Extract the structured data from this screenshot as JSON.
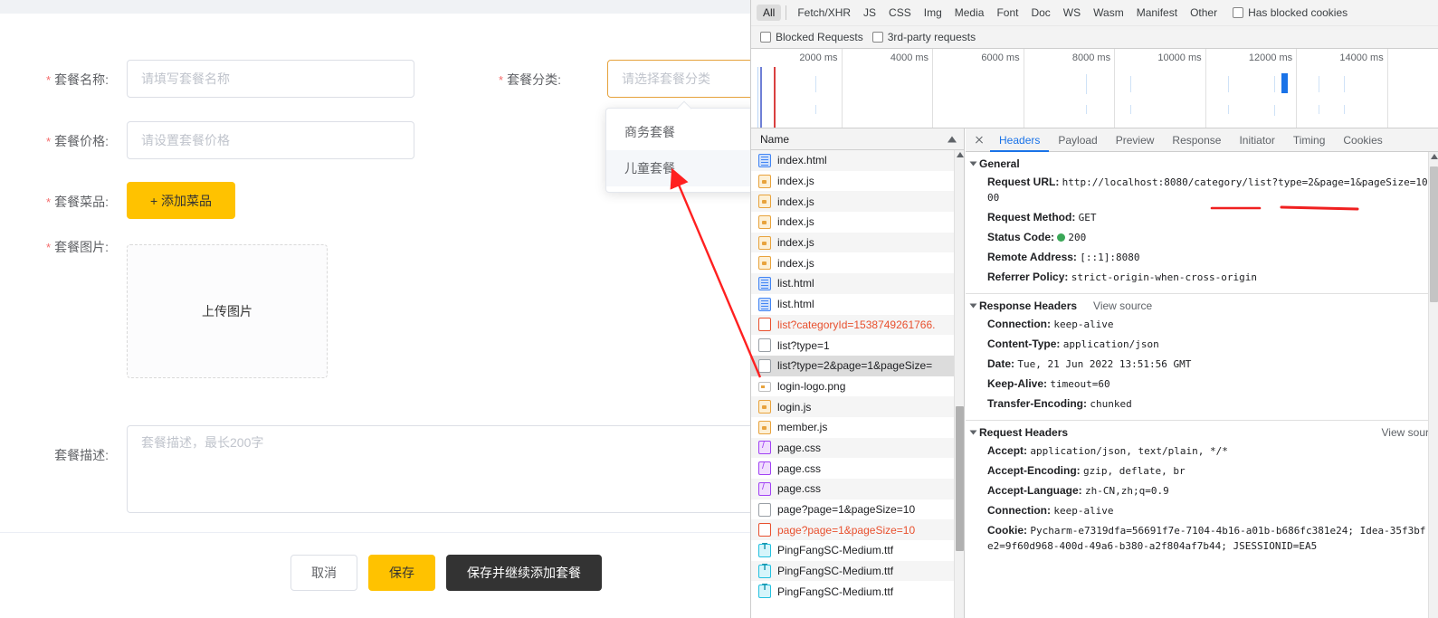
{
  "app_form": {
    "fields": {
      "name_label": "套餐名称:",
      "name_placeholder": "请填写套餐名称",
      "price_label": "套餐价格:",
      "price_placeholder": "请设置套餐价格",
      "dishes_label": "套餐菜品:",
      "add_dish_button": "+ 添加菜品",
      "image_label": "套餐图片:",
      "upload_text": "上传图片",
      "category_label": "套餐分类:",
      "category_placeholder": "请选择套餐分类",
      "desc_label": "套餐描述:",
      "desc_placeholder": "套餐描述，最长200字"
    },
    "category_options": [
      {
        "label": "商务套餐",
        "hover": false
      },
      {
        "label": "儿童套餐",
        "hover": true
      }
    ],
    "footer_buttons": {
      "cancel": "取消",
      "save": "保存",
      "save_continue": "保存并继续添加套餐"
    },
    "colors": {
      "primary_yellow": "#ffc200",
      "dark_button": "#333333",
      "required_star": "#f56c6c",
      "focus_border": "#e6a23c"
    }
  },
  "devtools": {
    "filter_types": [
      {
        "label": "All",
        "active": true
      },
      {
        "label": "Fetch/XHR",
        "active": false
      },
      {
        "label": "JS",
        "active": false
      },
      {
        "label": "CSS",
        "active": false
      },
      {
        "label": "Img",
        "active": false
      },
      {
        "label": "Media",
        "active": false
      },
      {
        "label": "Font",
        "active": false
      },
      {
        "label": "Doc",
        "active": false
      },
      {
        "label": "WS",
        "active": false
      },
      {
        "label": "Wasm",
        "active": false
      },
      {
        "label": "Manifest",
        "active": false
      },
      {
        "label": "Other",
        "active": false
      }
    ],
    "checkboxes": {
      "has_blocked_cookies": "Has blocked cookies",
      "blocked_requests": "Blocked Requests",
      "third_party_requests": "3rd-party requests"
    },
    "timeline_ticks": [
      "2000 ms",
      "4000 ms",
      "6000 ms",
      "8000 ms",
      "10000 ms",
      "12000 ms",
      "14000 ms"
    ],
    "name_column_header": "Name",
    "requests": [
      {
        "name": "index.html",
        "icon": "doc-icon",
        "error": false,
        "selected": false
      },
      {
        "name": "index.js",
        "icon": "js-icon",
        "error": false,
        "selected": false
      },
      {
        "name": "index.js",
        "icon": "js-icon",
        "error": false,
        "selected": false
      },
      {
        "name": "index.js",
        "icon": "js-icon",
        "error": false,
        "selected": false
      },
      {
        "name": "index.js",
        "icon": "js-icon",
        "error": false,
        "selected": false
      },
      {
        "name": "index.js",
        "icon": "js-icon",
        "error": false,
        "selected": false
      },
      {
        "name": "list.html",
        "icon": "doc-icon",
        "error": false,
        "selected": false
      },
      {
        "name": "list.html",
        "icon": "doc-icon",
        "error": false,
        "selected": false
      },
      {
        "name": "list?categoryId=1538749261766.",
        "icon": "xhr-error-icon",
        "error": true,
        "selected": false
      },
      {
        "name": "list?type=1",
        "icon": "xhr-icon",
        "error": false,
        "selected": false
      },
      {
        "name": "list?type=2&page=1&pageSize=",
        "icon": "xhr-icon",
        "error": false,
        "selected": true
      },
      {
        "name": "login-logo.png",
        "icon": "image-icon",
        "error": false,
        "selected": false
      },
      {
        "name": "login.js",
        "icon": "js-icon",
        "error": false,
        "selected": false
      },
      {
        "name": "member.js",
        "icon": "js-icon",
        "error": false,
        "selected": false
      },
      {
        "name": "page.css",
        "icon": "css-icon",
        "error": false,
        "selected": false
      },
      {
        "name": "page.css",
        "icon": "css-icon",
        "error": false,
        "selected": false
      },
      {
        "name": "page.css",
        "icon": "css-icon",
        "error": false,
        "selected": false
      },
      {
        "name": "page?page=1&pageSize=10",
        "icon": "xhr-icon",
        "error": false,
        "selected": false
      },
      {
        "name": "page?page=1&pageSize=10",
        "icon": "xhr-error-icon",
        "error": true,
        "selected": false
      },
      {
        "name": "PingFangSC-Medium.ttf",
        "icon": "font-icon",
        "error": false,
        "selected": false
      },
      {
        "name": "PingFangSC-Medium.ttf",
        "icon": "font-icon",
        "error": false,
        "selected": false
      },
      {
        "name": "PingFangSC-Medium.ttf",
        "icon": "font-icon",
        "error": false,
        "selected": false
      }
    ],
    "detail_tabs": [
      {
        "label": "Headers",
        "active": true
      },
      {
        "label": "Payload",
        "active": false
      },
      {
        "label": "Preview",
        "active": false
      },
      {
        "label": "Response",
        "active": false
      },
      {
        "label": "Initiator",
        "active": false
      },
      {
        "label": "Timing",
        "active": false
      },
      {
        "label": "Cookies",
        "active": false
      }
    ],
    "general": {
      "title": "General",
      "rows": [
        {
          "key": "Request URL:",
          "value": "http://localhost:8080/category/list?type=2&page=1&pageSize=1000"
        },
        {
          "key": "Request Method:",
          "value": "GET"
        },
        {
          "key": "Status Code:",
          "value": "200",
          "status_dot": true
        },
        {
          "key": "Remote Address:",
          "value": "[::1]:8080"
        },
        {
          "key": "Referrer Policy:",
          "value": "strict-origin-when-cross-origin"
        }
      ]
    },
    "response_headers": {
      "title": "Response Headers",
      "view_source": "View source",
      "rows": [
        {
          "key": "Connection:",
          "value": "keep-alive"
        },
        {
          "key": "Content-Type:",
          "value": "application/json"
        },
        {
          "key": "Date:",
          "value": "Tue, 21 Jun 2022 13:51:56 GMT"
        },
        {
          "key": "Keep-Alive:",
          "value": "timeout=60"
        },
        {
          "key": "Transfer-Encoding:",
          "value": "chunked"
        }
      ]
    },
    "request_headers": {
      "title": "Request Headers",
      "view_source": "View sour",
      "rows": [
        {
          "key": "Accept:",
          "value": "application/json, text/plain, */*"
        },
        {
          "key": "Accept-Encoding:",
          "value": "gzip, deflate, br"
        },
        {
          "key": "Accept-Language:",
          "value": "zh-CN,zh;q=0.9"
        },
        {
          "key": "Connection:",
          "value": "keep-alive"
        },
        {
          "key": "Cookie:",
          "value": "Pycharm-e7319dfa=56691f7e-7104-4b16-a01b-b686fc381e24; Idea-35f3bfe2=9f60d968-400d-49a6-b380-a2f804af7b44; JSESSIONID=EA5"
        }
      ]
    }
  },
  "annotations": {
    "arrow_color": "#ff2020",
    "underline_color": "#f02020"
  }
}
